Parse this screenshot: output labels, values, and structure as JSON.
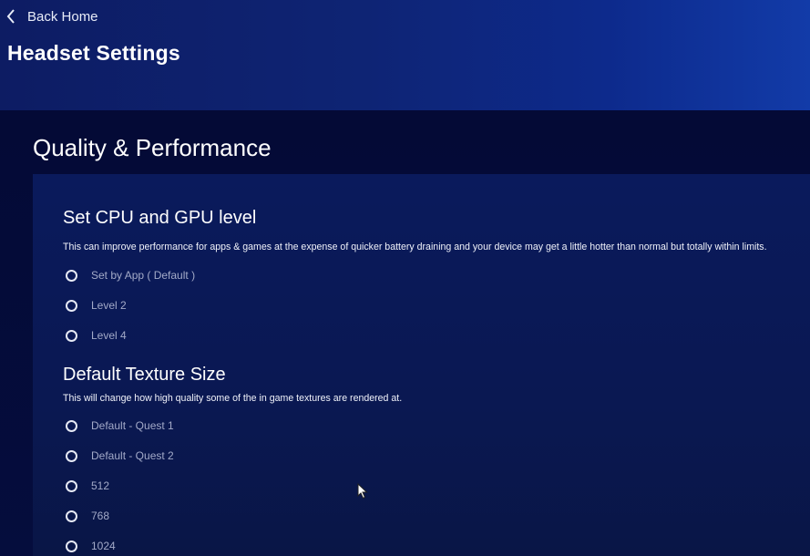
{
  "header": {
    "back_label": "Back Home",
    "title": "Headset Settings"
  },
  "section": {
    "title": "Quality & Performance"
  },
  "cpu_gpu": {
    "title": "Set CPU and GPU level",
    "description": "This can improve performance for apps & games at the expense of quicker battery draining and your device may get a little hotter than normal but totally within limits.",
    "options": [
      {
        "label": "Set by App ( Default )"
      },
      {
        "label": "Level 2"
      },
      {
        "label": "Level 4"
      }
    ]
  },
  "texture": {
    "title": "Default Texture Size",
    "description": "This will change how high quality some of the in game textures are rendered at.",
    "options": [
      {
        "label": "Default - Quest 1"
      },
      {
        "label": "Default - Quest 2"
      },
      {
        "label": "512"
      },
      {
        "label": "768"
      },
      {
        "label": "1024"
      }
    ]
  },
  "icons": {
    "back": "chevron-left-icon",
    "cursor": "mouse-pointer-icon"
  },
  "colors": {
    "header_bg": "#0e2474",
    "main_bg": "#040a36",
    "panel_bg": "#0a1a5c",
    "option_label": "#a3aac8",
    "text": "#ffffff"
  }
}
